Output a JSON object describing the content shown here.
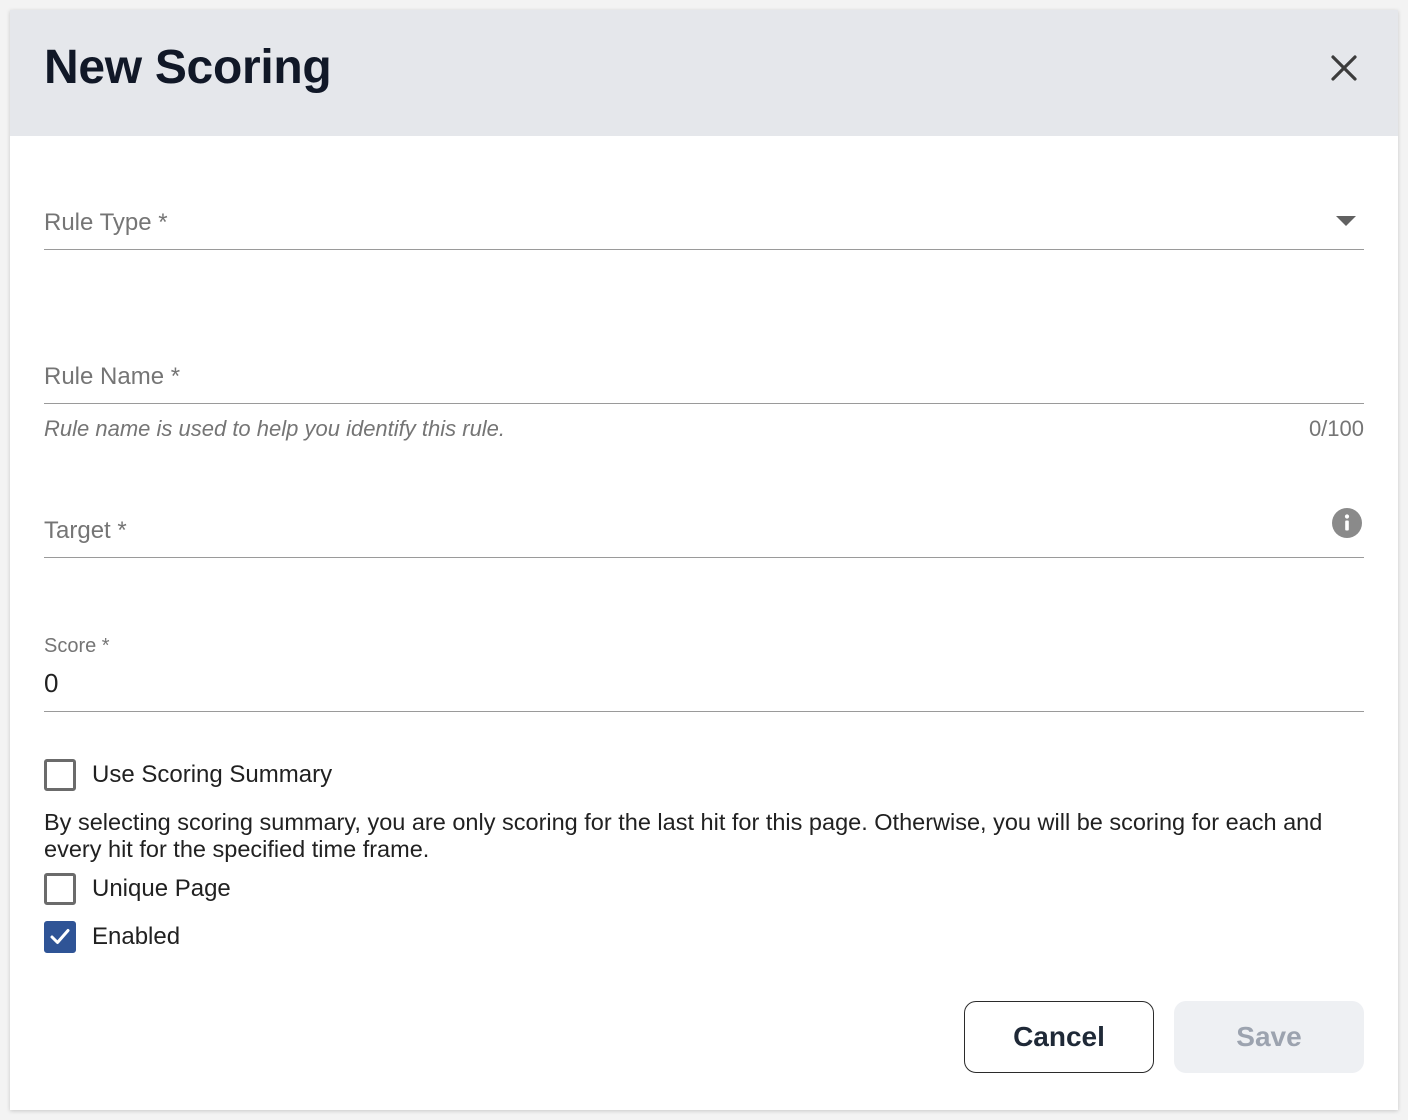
{
  "dialog": {
    "title": "New Scoring",
    "close_icon": "close-icon"
  },
  "fields": {
    "rule_type": {
      "label": "Rule Type *",
      "value": ""
    },
    "rule_name": {
      "label": "Rule Name *",
      "value": "",
      "hint": "Rule name is used to help you identify this rule.",
      "counter": "0/100"
    },
    "target": {
      "label": "Target *",
      "value": "",
      "icon": "info-icon"
    },
    "score": {
      "label": "Score *",
      "value": "0"
    }
  },
  "checkboxes": {
    "use_scoring_summary": {
      "label": "Use Scoring Summary",
      "checked": false
    },
    "description": "By selecting scoring summary, you are only scoring for the last hit for this page. Otherwise, you will be scoring for each and every hit for the specified time frame.",
    "unique_page": {
      "label": "Unique Page",
      "checked": false
    },
    "enabled": {
      "label": "Enabled",
      "checked": true
    }
  },
  "buttons": {
    "cancel": "Cancel",
    "save": "Save"
  },
  "colors": {
    "header_bg": "#e5e7eb",
    "accent": "#2f5496",
    "disabled_bg": "#eef0f3",
    "disabled_text": "#9ca3af"
  }
}
